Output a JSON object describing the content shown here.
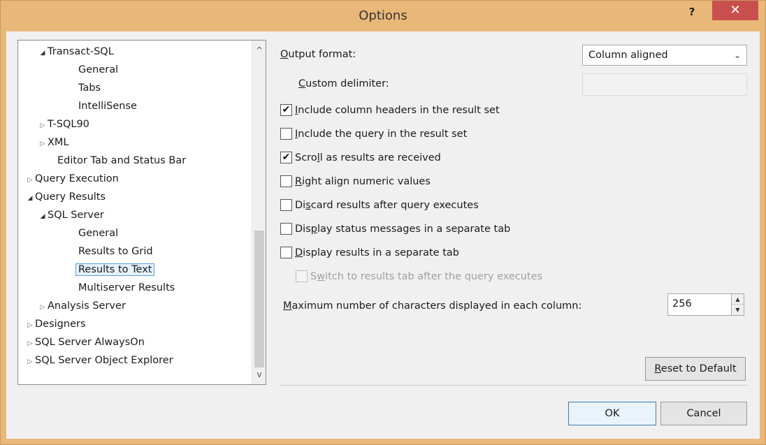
{
  "window": {
    "title": "Options",
    "help_glyph": "?",
    "close_glyph": "✕"
  },
  "tree": {
    "items": [
      {
        "label": "Transact-SQL",
        "expander": "open"
      },
      {
        "label": "General",
        "expander": ""
      },
      {
        "label": "Tabs",
        "expander": ""
      },
      {
        "label": "IntelliSense",
        "expander": ""
      },
      {
        "label": "T-SQL90",
        "expander": "closed"
      },
      {
        "label": "XML",
        "expander": "closed"
      },
      {
        "label": "Editor Tab and Status Bar",
        "expander": ""
      },
      {
        "label": "Query Execution",
        "expander": "closed"
      },
      {
        "label": "Query Results",
        "expander": "open"
      },
      {
        "label": "SQL Server",
        "expander": "open"
      },
      {
        "label": "General",
        "expander": ""
      },
      {
        "label": "Results to Grid",
        "expander": ""
      },
      {
        "label": "Results to Text",
        "expander": "",
        "selected": true
      },
      {
        "label": "Multiserver Results",
        "expander": ""
      },
      {
        "label": "Analysis Server",
        "expander": "closed"
      },
      {
        "label": "Designers",
        "expander": "closed"
      },
      {
        "label": "SQL Server AlwaysOn",
        "expander": "closed"
      },
      {
        "label": "SQL Server Object Explorer",
        "expander": "closed"
      }
    ],
    "scroll_up_glyph": "^",
    "scroll_down_glyph": "v"
  },
  "options": {
    "output_format_label_pre": "",
    "output_format_label_u": "O",
    "output_format_label_post": "utput format:",
    "output_format_value": "Column aligned",
    "custom_delimiter_label_u": "C",
    "custom_delimiter_label_post": "ustom delimiter:",
    "custom_delimiter_value": "",
    "checkboxes": [
      {
        "pre": "",
        "u": "I",
        "post": "nclude column headers in the result set",
        "checked": true,
        "enabled": true
      },
      {
        "pre": "",
        "u": "I",
        "post": "nclude the query in the result set",
        "checked": false,
        "enabled": true
      },
      {
        "pre": "Scro",
        "u": "l",
        "post": "l as results are received",
        "checked": true,
        "enabled": true
      },
      {
        "pre": "",
        "u": "R",
        "post": "ight align numeric values",
        "checked": false,
        "enabled": true
      },
      {
        "pre": "Di",
        "u": "s",
        "post": "card results after query executes",
        "checked": false,
        "enabled": true
      },
      {
        "pre": "Dis",
        "u": "p",
        "post": "lay status messages in a separate tab",
        "checked": false,
        "enabled": true
      },
      {
        "pre": "",
        "u": "D",
        "post": "isplay results in a separate tab",
        "checked": false,
        "enabled": true
      },
      {
        "pre": "S",
        "u": "w",
        "post": "itch to results tab after the query executes",
        "checked": false,
        "enabled": false
      }
    ],
    "max_chars_label_u": "M",
    "max_chars_label_post": "aximum number of characters displayed in each column:",
    "max_chars_value": "256",
    "check_glyph": "✔",
    "dropdown_caret": "⌄",
    "spin_up": "▲",
    "spin_down": "▼"
  },
  "buttons": {
    "reset_u": "R",
    "reset_post": "eset to Default",
    "ok": "OK",
    "cancel": "Cancel"
  }
}
